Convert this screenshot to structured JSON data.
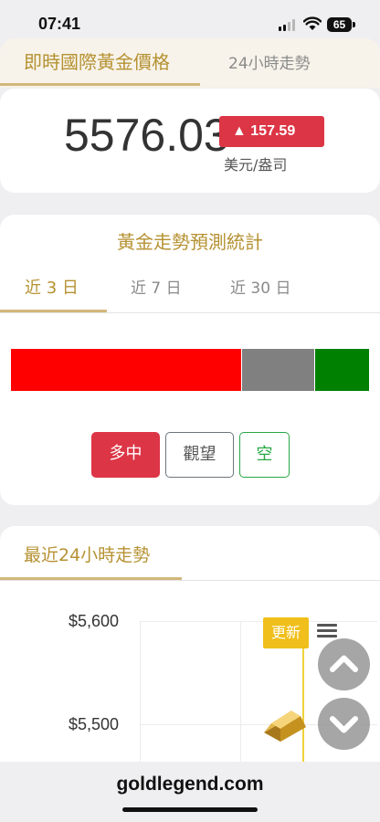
{
  "status_bar": {
    "time": "07:41",
    "battery": "65"
  },
  "top_tabs": {
    "active": "即時國際黃金價格",
    "other": "24小時走勢"
  },
  "price": {
    "value": "5576.03",
    "change": "▲ 157.59",
    "unit": "美元/盎司",
    "change_color": "#dc3545"
  },
  "forecast": {
    "title": "黃金走勢預測統計",
    "periods": [
      "近 3 日",
      "近 7 日",
      "近 30 日"
    ],
    "active_period": "近 3 日",
    "distribution": [
      {
        "label": "多中",
        "share": 0.645,
        "color": "#ff0000"
      },
      {
        "label": "觀望",
        "share": 0.205,
        "color": "#808080"
      },
      {
        "label": "空",
        "share": 0.15,
        "color": "#008000"
      }
    ],
    "buttons": {
      "long": "多中",
      "wait": "觀望",
      "short": "空"
    }
  },
  "trend": {
    "title": "最近24小時走勢",
    "y_ticks": [
      "$5,600",
      "$5,500"
    ],
    "update_label": "更新"
  },
  "icons": {
    "menu": "hamburger-menu-icon",
    "scroll_up": "chevron-up-icon",
    "scroll_down": "chevron-down-icon",
    "gold": "gold-bar-icon"
  },
  "footer": {
    "url": "goldlegend.com"
  },
  "colors": {
    "accent": "#b59131",
    "red": "#dc3545",
    "green": "#28a745",
    "update": "#f0bf1b"
  }
}
